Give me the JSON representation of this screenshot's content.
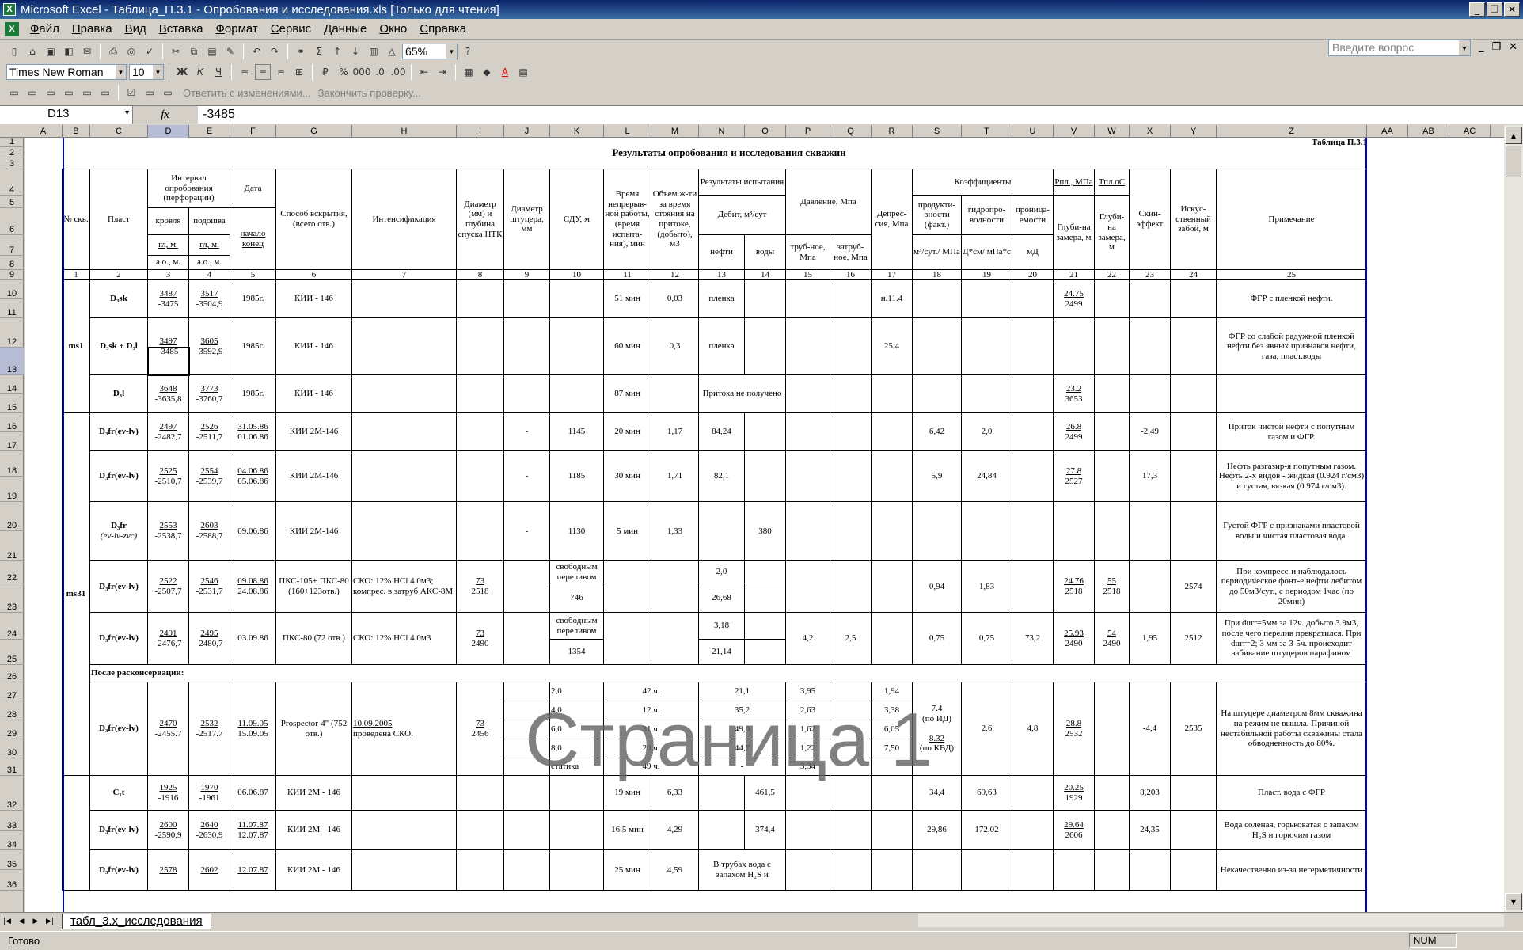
{
  "window": {
    "title": "Microsoft Excel - Таблица_П.3.1 - Опробования и исследования.xls  [Только для чтения]",
    "app_icon": "excel-icon"
  },
  "menu": [
    "Файл",
    "Правка",
    "Вид",
    "Вставка",
    "Формат",
    "Сервис",
    "Данные",
    "Окно",
    "Справка"
  ],
  "help_placeholder": "Введите вопрос",
  "toolbar": {
    "zoom": "65%",
    "font_name": "Times New Roman",
    "font_size": "10",
    "bold": "Ж",
    "italic": "К",
    "underline": "Ч",
    "review_reply": "Ответить с изменениями...",
    "review_end": "Закончить проверку..."
  },
  "formula_bar": {
    "name_box": "D13",
    "fx": "fx",
    "value": "-3485"
  },
  "columns": [
    "A",
    "B",
    "C",
    "D",
    "E",
    "F",
    "G",
    "H",
    "I",
    "J",
    "K",
    "L",
    "M",
    "N",
    "O",
    "P",
    "Q",
    "R",
    "S",
    "T",
    "U",
    "V",
    "W",
    "X",
    "Y",
    "Z",
    "AA",
    "AB",
    "AC"
  ],
  "rows": [
    "1",
    "2",
    "3",
    "4",
    "5",
    "6",
    "7",
    "8",
    "9",
    "10",
    "11",
    "12",
    "13",
    "14",
    "15",
    "16",
    "17",
    "18",
    "19",
    "20",
    "21",
    "22",
    "23",
    "24",
    "25",
    "26",
    "27",
    "28",
    "29",
    "30",
    "31",
    "32",
    "33",
    "34",
    "35",
    "36"
  ],
  "sheet": {
    "table_label": "Таблица П.3.1",
    "title": "Результаты опробования и исследования скважин",
    "headers": {
      "well": "№ скв.",
      "layer": "Пласт",
      "interval": "Интервал опробования (перфорации)",
      "top": "кровля",
      "bottom": "подошва",
      "hm": "гл, м.",
      "ao": "а.о., м.",
      "date": "Дата",
      "date_sub": "начало конец",
      "method": "Способ вскрытия, (всего отв.)",
      "intens": "Интенсификация",
      "diam_ntk": "Диаметр (мм) и глубина спуска НТК",
      "diam_sh": "Диаметр штуцера, мм",
      "sdu": "СДУ, м",
      "time": "Время непрерыв-ной работы, (время испыта-ния), мин",
      "volume": "Объем ж-ти за время стояния на притоке, (добыто), м3",
      "results": "Результаты испытания",
      "debit": "Дебит, м³/сут",
      "oil": "нефти",
      "water": "воды",
      "pressure": "Давление, Мпа",
      "tube": "труб-ное, Мпа",
      "annulus": "затруб-ное, Мпа",
      "depress": "Депрес-сия, Мпа",
      "coef": "Коэффициенты",
      "prod": "продукти-вности (факт.)",
      "prod_unit": "м³/сут./ МПа",
      "hydro": "гидропро-водности",
      "hydro_unit": "Д*см/ мПа*с",
      "perm": "проница-емости",
      "perm_unit": "мД",
      "rpl": "Рпл., МПа",
      "rpl_sub": "Глуби-на замера, м",
      "tpl": "Тпл.оС",
      "tpl_sub": "Глуби-на замера, м",
      "skin": "Скин-эффект",
      "bottom_hole": "Искус-ственный забой, м",
      "remark": "Примечание",
      "nums": [
        "1",
        "2",
        "3",
        "4",
        "5",
        "6",
        "7",
        "8",
        "9",
        "10",
        "11",
        "12",
        "13",
        "14",
        "15",
        "16",
        "17",
        "18",
        "19",
        "20",
        "21",
        "22",
        "23",
        "24",
        "25"
      ]
    },
    "groups": {
      "ms1": "ms1",
      "ms31": "ms31",
      "after": "После расконсервации:"
    },
    "rec": [
      {
        "layer": "D₃sk",
        "top_h": "3487",
        "top_a": "-3475",
        "bot_h": "3517",
        "bot_a": "-3504,9",
        "date": "1985г.",
        "method": "КИИ - 146",
        "time": "51 мин",
        "vol": "0,03",
        "oil": "пленка",
        "depress": "н.11.4",
        "rpl": "24.75",
        "rpl_d": "2499",
        "note": "ФГР с пленкой нефти."
      },
      {
        "layer": "D₃sk + D₃l",
        "top_h": "3497",
        "top_a": "-3485",
        "bot_h": "3605",
        "bot_a": "-3592,9",
        "date": "1985г.",
        "method": "КИИ - 146",
        "time": "60 мин",
        "vol": "0,3",
        "oil": "пленка",
        "depress": "25,4",
        "note": "ФГР со слабой радужной пленкой нефти без явных признаков нефти, газа, пласт.воды"
      },
      {
        "layer": "D₃l",
        "top_h": "3648",
        "top_a": "-3635,8",
        "bot_h": "3773",
        "bot_a": "-3760,7",
        "date": "1985г.",
        "method": "КИИ - 146",
        "time": "87 мин",
        "oil": "Притока не получено",
        "rpl": "23.2",
        "rpl_d": "3653"
      },
      {
        "layer": "D₃fr(ev-lv)",
        "top_h": "2497",
        "top_a": "-2482,7",
        "bot_h": "2526",
        "bot_a": "-2511,7",
        "date1": "31.05.86",
        "date2": "01.06.86",
        "method": "КИИ 2М-146",
        "diam": "-",
        "sdu": "1145",
        "time": "20 мин",
        "vol": "1,17",
        "oil": "84,24",
        "prod": "6,42",
        "hydro": "2,0",
        "rpl": "26.8",
        "rpl_d": "2499",
        "skin": "-2,49",
        "note": "Приток чистой нефти с попутным газом и ФГР."
      },
      {
        "layer": "D₃fr(ev-lv)",
        "top_h": "2525",
        "top_a": "-2510,7",
        "bot_h": "2554",
        "bot_a": "-2539,7",
        "date1": "04.06.86",
        "date2": "05.06.86",
        "method": "КИИ 2М-146",
        "diam": "-",
        "sdu": "1185",
        "time": "30 мин",
        "vol": "1,71",
        "oil": "82,1",
        "prod": "5,9",
        "hydro": "24,84",
        "rpl": "27.8",
        "rpl_d": "2527",
        "skin": "17,3",
        "note": "Нефть разгазир-я попутным газом. Нефть 2-х видов - жидкая (0.924 г/см3) и густая, вязкая (0.974 г/см3)."
      },
      {
        "layer": "D₃fr",
        "layer2": "(ev-lv-zvc)",
        "top_h": "2553",
        "top_a": "-2538,7",
        "bot_h": "2603",
        "bot_a": "-2588,7",
        "date": "09.06.86",
        "method": "КИИ 2М-146",
        "diam": "-",
        "sdu": "1130",
        "time": "5 мин",
        "vol": "1,33",
        "water": "380",
        "note": "Густой ФГР с признаками пластовой воды и чистая пластовая вода."
      },
      {
        "layer": "D₃fr(ev-lv)",
        "top_h": "2522",
        "top_a": "-2507,7",
        "bot_h": "2546",
        "bot_a": "-2531,7",
        "date1": "09.08.86",
        "date2": "24.08.86",
        "method": "ПКС-105+ ПКС-80 (160+123отв.)",
        "intens": "СКО: 12% HCl 4.0м3; компрес. в затруб АКС-8М",
        "ntk": "73",
        "ntk_d": "2518",
        "sdu_a": "свободным переливом",
        "sdu_b": "746",
        "oil_a": "2,0",
        "oil_b": "26,68",
        "prod": "0,94",
        "hydro": "1,83",
        "rpl": "24.76",
        "rpl_d": "2518",
        "tpl": "55",
        "tpl_d": "2518",
        "bh": "2574",
        "note": "При компресс-и наблюдалось периодическое фонт-е нефти дебитом до 50м3/сут., с периодом 1час (по 20мин)"
      },
      {
        "layer": "D₃fr(ev-lv)",
        "top_h": "2491",
        "top_a": "-2476,7",
        "bot_h": "2495",
        "bot_a": "-2480,7",
        "date": "03.09.86",
        "method": "ПКС-80 (72 отв.)",
        "intens": "СКО: 12% HCl 4.0м3",
        "ntk": "73",
        "ntk_d": "2490",
        "sdu_a": "свободным переливом",
        "sdu_b": "1354",
        "oil_a": "3,18",
        "oil_b": "21,14",
        "tube": "4,2",
        "ann": "2,5",
        "prod": "0,75",
        "hydro": "0,75",
        "perm": "73,2",
        "rpl": "25.93",
        "rpl_d": "2490",
        "tpl": "54",
        "tpl_d": "2490",
        "skin": "1,95",
        "bh": "2512",
        "note": "При dшт=5мм за 12ч. добыто 3.9м3, после чего перелив прекратился. При dшт=2; 3 мм за 3-5ч. происходит забивание штуцеров парафином"
      },
      {
        "layer": "D₃fr(ev-lv)",
        "top_h": "2470",
        "top_a": "-2455.7",
        "bot_h": "2532",
        "bot_a": "-2517.7",
        "date1": "11.09.05",
        "date2": "15.09.05",
        "method": "Prospector-4\" (752 отв.)",
        "intens": "10.09.2005",
        "intens2": "проведена СКО.",
        "ntk": "73",
        "ntk_d": "2456",
        "prod_a": "7.4",
        "prod_a2": "(по ИД)",
        "prod_b": "8.32",
        "prod_b2": "(по КВД)",
        "hydro": "2,6",
        "perm": "4,8",
        "rpl": "28.8",
        "rpl_d": "2532",
        "skin": "-4,4",
        "bh": "2535",
        "note": "На штуцере диаметром 8мм скважина на режим не вышла. Причиной нестабильной работы скважины стала обводненность до 80%.",
        "sub": [
          [
            "2,0",
            "42 ч.",
            "21,1",
            "3,95",
            "1,94"
          ],
          [
            "4,0",
            "12 ч.",
            "35,2",
            "2,63",
            "3,38"
          ],
          [
            "6,0",
            "31 ч.",
            "49,0",
            "1,62",
            "6,05"
          ],
          [
            "8,0",
            "20 ч.",
            "44,7",
            "1,22",
            "7,50"
          ],
          [
            "статика",
            "49 ч.",
            "-",
            "3,34",
            ""
          ]
        ]
      },
      {
        "layer": "C₁t",
        "top_h": "1925",
        "top_a": "-1916",
        "bot_h": "1970",
        "bot_a": "-1961",
        "date": "06.06.87",
        "method": "КИИ 2М - 146",
        "time": "19 мин",
        "vol": "6,33",
        "water": "461,5",
        "prod": "34,4",
        "hydro": "69,63",
        "rpl": "20.25",
        "rpl_d": "1929",
        "skin": "8,203",
        "note": "Пласт. вода с ФГР"
      },
      {
        "layer": "D₃fr(ev-lv)",
        "top_h": "2600",
        "top_a": "-2590,9",
        "bot_h": "2640",
        "bot_a": "-2630,9",
        "date1": "11.07.87",
        "date2": "12.07.87",
        "method": "КИИ 2М - 146",
        "time": "16.5 мин",
        "vol": "4,29",
        "water": "374,4",
        "prod": "29,86",
        "hydro": "172,02",
        "rpl": "29.64",
        "rpl_d": "2606",
        "skin": "24,35",
        "note": "Вода соленая, горьковатая с запахом H₂S и горючим газом"
      },
      {
        "layer": "D₃fr(ev-lv)",
        "top_h": "2578",
        "bot_h": "2602",
        "date1": "12.07.87",
        "method": "КИИ 2М - 146",
        "time": "25 мин",
        "vol": "4,59",
        "oil": "В трубах вода с запахом H₂S и",
        "note": "Некачественно из-за негерметичности"
      }
    ]
  },
  "watermark": "Страница 1",
  "sheet_tab": "табл_3.х_исследования",
  "status": {
    "ready": "Готово",
    "num": "NUM"
  }
}
